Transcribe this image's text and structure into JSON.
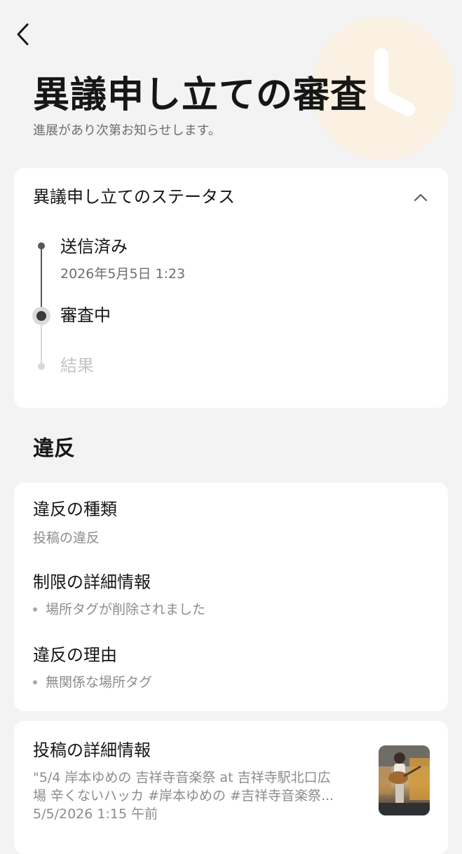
{
  "header": {
    "title": "異議申し立ての審査",
    "subtitle": "進展があり次第お知らせします。"
  },
  "status_card": {
    "title": "異議申し立てのステータス",
    "steps": [
      {
        "label": "送信済み",
        "date": "2026年5月5日 1:23",
        "state": "done"
      },
      {
        "label": "審査中",
        "state": "current"
      },
      {
        "label": "結果",
        "state": "pending"
      }
    ]
  },
  "violation_section": {
    "heading": "違反",
    "type_label": "違反の種類",
    "type_value": "投稿の違反",
    "restriction_label": "制限の詳細情報",
    "restriction_items": [
      "場所タグが削除されました"
    ],
    "reason_label": "違反の理由",
    "reason_items": [
      "無関係な場所タグ"
    ]
  },
  "post_card": {
    "title": "投稿の詳細情報",
    "caption_line1": "\"5/4 岸本ゆめの 吉祥寺音楽祭 at 吉祥寺駅北口広",
    "caption_line2": "場 辛くないハッカ #岸本ゆめの #吉祥寺音楽祭...",
    "date": "5/5/2026 1:15 午前"
  },
  "colors": {
    "background": "#f3f3f4",
    "card": "#ffffff",
    "text_primary": "#161616",
    "text_secondary": "#6d6d6d",
    "clock_circle": "#fbf1e2",
    "clock_hands": "#ffffff"
  },
  "icons": {
    "back": "chevron-left-icon",
    "collapse": "chevron-up-icon",
    "decoration": "clock-icon"
  }
}
